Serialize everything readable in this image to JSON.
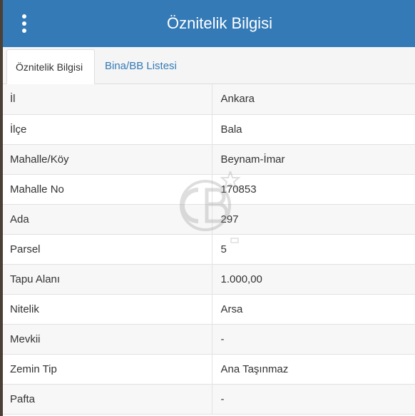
{
  "header": {
    "title": "Öznitelik Bilgisi",
    "menu_icon": "more-vertical-icon"
  },
  "tabs": [
    {
      "label": "Öznitelik Bilgisi",
      "active": true
    },
    {
      "label": "Bina/BB Listesi",
      "active": false
    }
  ],
  "rows": [
    {
      "label": "İl",
      "value": "Ankara"
    },
    {
      "label": "İlçe",
      "value": "Bala"
    },
    {
      "label": "Mahalle/Köy",
      "value": "Beynam-İmar"
    },
    {
      "label": "Mahalle No",
      "value": "170853"
    },
    {
      "label": "Ada",
      "value": "297"
    },
    {
      "label": "Parsel",
      "value": "5"
    },
    {
      "label": "Tapu Alanı",
      "value": "1.000,00"
    },
    {
      "label": "Nitelik",
      "value": "Arsa"
    },
    {
      "label": "Mevkii",
      "value": "-"
    },
    {
      "label": "Zemin Tip",
      "value": "Ana Taşınmaz"
    },
    {
      "label": "Pafta",
      "value": "-"
    }
  ],
  "colors": {
    "header": "#337ab7",
    "link": "#337ab7"
  },
  "watermark": {
    "icon": "cb-logo-watermark"
  }
}
